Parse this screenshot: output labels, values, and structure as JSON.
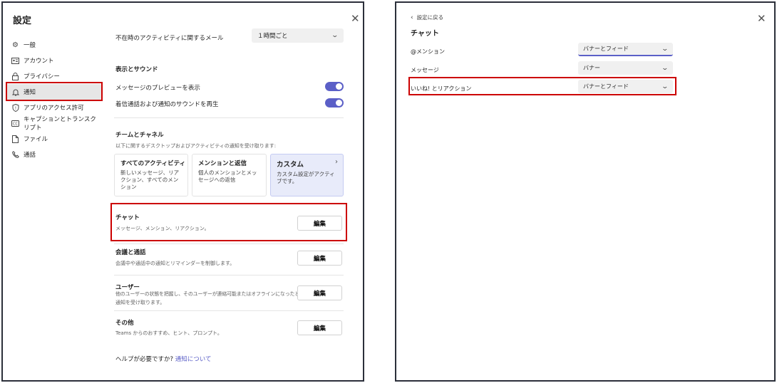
{
  "settings_dialog": {
    "title": "設定",
    "close_icon": "close-icon",
    "nav": [
      {
        "icon": "gear-icon",
        "label": "一般"
      },
      {
        "icon": "id-card-icon",
        "label": "アカウント"
      },
      {
        "icon": "lock-icon",
        "label": "プライバシー"
      },
      {
        "icon": "bell-icon",
        "label": "通知",
        "selected": true
      },
      {
        "icon": "shield-icon",
        "label": "アプリのアクセス許可"
      },
      {
        "icon": "cc-icon",
        "label": "キャプションとトランスクリプト"
      },
      {
        "icon": "file-icon",
        "label": "ファイル"
      },
      {
        "icon": "phone-icon",
        "label": "通話"
      }
    ],
    "away_email": {
      "label": "不在時のアクティビティに関するメール",
      "value": "１時間ごと"
    },
    "display_sound": {
      "heading": "表示とサウンド",
      "preview": {
        "label": "メッセージのプレビューを表示",
        "on": true
      },
      "sound": {
        "label": "着信通話および通知のサウンドを再生",
        "on": true
      }
    },
    "teams_channels": {
      "heading": "チームとチャネル",
      "description": "以下に関するデスクトップおよびアクティビティの通知を受け取ります:",
      "cards": [
        {
          "title": "すべてのアクティビティ",
          "desc": "新しいメッセージ、リアクション、すべてのメンション"
        },
        {
          "title": "メンションと返信",
          "desc": "個人のメンションとメッセージへの返信"
        },
        {
          "title": "カスタム",
          "desc": "カスタム設定がアクティブです。",
          "selected": true
        }
      ]
    },
    "sections": [
      {
        "title": "チャット",
        "desc": "メッセージ、メンション、リアクション。",
        "button": "編集"
      },
      {
        "title": "会議と通話",
        "desc": "会議中や通話中の通知とリマインダーを制御します。",
        "button": "編集"
      },
      {
        "title": "ユーザー",
        "desc_line1": "他のユーザーの状態を把握し、そのユーザーが連絡可能またはオフラインになったときに",
        "desc_line2": "通知を受け取ります。",
        "button": "編集"
      },
      {
        "title": "その他",
        "desc": "Teams からのおすすめ、ヒント、プロンプト。",
        "button": "編集"
      }
    ],
    "help": {
      "text": "ヘルプが必要ですか?",
      "link": "通知について"
    }
  },
  "chat_dialog": {
    "back_label": "設定に戻る",
    "title": "チャット",
    "rows": [
      {
        "label": "@メンション",
        "value": "バナーとフィード"
      },
      {
        "label": "メッセージ",
        "value": "バナー"
      },
      {
        "label": "いいね! とリアクション",
        "value": "バナーとフィード"
      }
    ]
  },
  "colors": {
    "accent": "#5b5fc7",
    "highlight": "#cc0000",
    "panel_border": "#2b2f3a"
  }
}
